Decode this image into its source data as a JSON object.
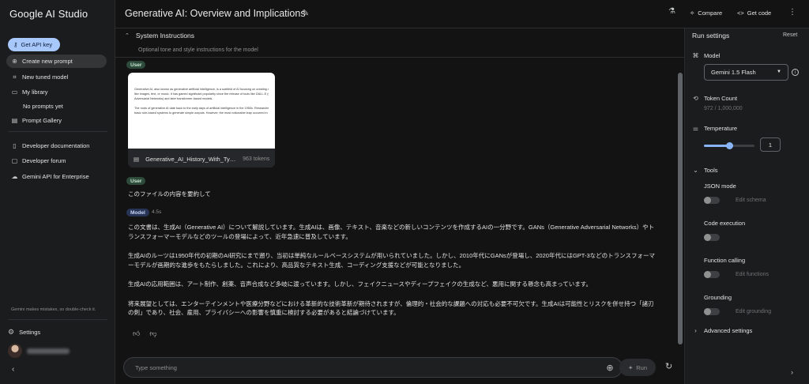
{
  "app": {
    "name": "Google AI Studio"
  },
  "sidebar": {
    "api_key": "Get API key",
    "items": [
      {
        "label": "Create new prompt",
        "icon": "plus-circle-icon"
      },
      {
        "label": "New tuned model",
        "icon": "tune-icon"
      },
      {
        "label": "My library",
        "icon": "folder-icon"
      },
      {
        "label": "No prompts yet"
      },
      {
        "label": "Prompt Gallery",
        "icon": "book-icon"
      }
    ],
    "links": [
      {
        "label": "Developer documentation",
        "icon": "document-icon"
      },
      {
        "label": "Developer forum",
        "icon": "forum-icon"
      },
      {
        "label": "Gemini API for Enterprise",
        "icon": "cloud-icon"
      }
    ],
    "disclaimer": "Gemini makes mistakes, so double-check it.",
    "settings": "Settings"
  },
  "header": {
    "title": "Generative AI: Overview and Implications",
    "compare": "Compare",
    "get_code": "Get code"
  },
  "system_instructions": {
    "title": "System Instructions",
    "placeholder": "Optional tone and style instructions for the model"
  },
  "chat": {
    "user_label": "User",
    "model_label": "Model",
    "attachment": {
      "name": "Generative_AI_History_With_Typ...",
      "tokens": "963 tokens",
      "preview_lines": [
        "Generative AI, also known as generative artificial intelligence, is a subfield of AI focusing on creating new content",
        "like images, text, or music. It has gained significant popularity since the release of tools like DALL-E (Generative",
        "Adversarial Networks) and later transformer-based models.",
        "",
        "The roots of generative AI date back to the early days of artificial intelligence in the 1950s. Researchers explored",
        "basic rule-based systems to generate simple outputs. However, the most noticeable leap occurred in"
      ]
    },
    "user_message": "このファイルの内容を要約して",
    "model_latency": "4.5s",
    "model_paragraphs": [
      "この文書は、生成AI（Generative AI）について解説しています。生成AIは、画像、テキスト、音楽などの新しいコンテンツを作成するAIの一分野です。GANs（Generative Adversarial Networks）やトランスフォーマーモデルなどのツールの登場によって、近年急速に普及しています。",
      "生成AIのルーツは1950年代の初期のAI研究にまで遡り、当初は単純なルールベースシステムが用いられていました。しかし、2010年代にGANsが登場し、2020年代にはGPT-3などのトランスフォーマーモデルが画期的な進歩をもたらしました。これにより、高品質なテキスト生成、コーディング支援などが可能となりました。",
      "生成AIの応用範囲は、アート制作、創薬、音声合成など多岐に渡っています。しかし、フェイクニュースやディープフェイクの生成など、悪用に関する懸念も高まっています。",
      "将来展望としては、エンターテインメントや医療分野などにおける革新的な技術革新が期待されますが、倫理的・社会的な課題への対応も必要不可欠です。生成AIは可能性とリスクを併せ持つ「諸刃の剣」であり、社会、雇用、プライバシーへの影響を慎重に検討する必要があると結論づけています。"
    ]
  },
  "composer": {
    "placeholder": "Type something",
    "run": "Run"
  },
  "run_settings": {
    "title": "Run settings",
    "reset": "Reset",
    "model_label": "Model",
    "model_value": "Gemini 1.5 Flash",
    "token_label": "Token Count",
    "token_value": "972 / 1,000,000",
    "temperature_label": "Temperature",
    "temperature_value": "1",
    "temperature_fraction": 0.5,
    "tools_label": "Tools",
    "tools": [
      {
        "label": "JSON mode",
        "link": "Edit schema",
        "enabled": false
      },
      {
        "label": "Code execution",
        "link": "",
        "enabled": false
      },
      {
        "label": "Function calling",
        "link": "Edit functions",
        "enabled": false
      },
      {
        "label": "Grounding",
        "link": "Edit grounding",
        "enabled": false
      }
    ],
    "advanced": "Advanced settings"
  },
  "colors": {
    "accent": "#a8c7fa",
    "background": "#131314",
    "panel": "#1b1c1d",
    "slider": "#8ab4f8"
  }
}
